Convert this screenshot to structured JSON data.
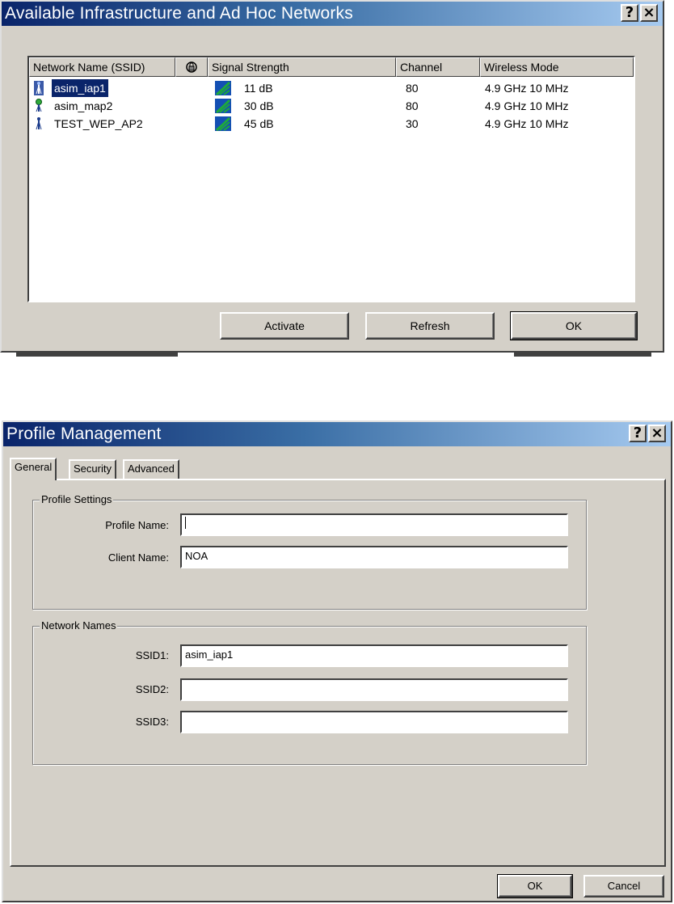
{
  "dialog1": {
    "title": "Available Infrastructure and Ad Hoc Networks",
    "help_icon": "?",
    "close_icon": "×",
    "columns": [
      "Network Name (SSID)",
      "",
      "Signal Strength",
      "Channel",
      "Wireless Mode"
    ],
    "column_icon": "encryption-lock-icon",
    "rows": [
      {
        "name": "asim_iap1",
        "signal": "11 dB",
        "channel": "80",
        "mode": "4.9 GHz 10 MHz",
        "icon": "infrastructure-tower-icon",
        "selected": true
      },
      {
        "name": "asim_map2",
        "signal": "30 dB",
        "channel": "80",
        "mode": "4.9 GHz 10 MHz",
        "icon": "adhoc-tower-icon",
        "selected": false
      },
      {
        "name": "TEST_WEP_AP2",
        "signal": "45 dB",
        "channel": "30",
        "mode": "4.9 GHz 10 MHz",
        "icon": "infrastructure-tower-icon",
        "selected": false
      }
    ],
    "buttons": {
      "activate": "Activate",
      "refresh": "Refresh",
      "ok": "OK"
    }
  },
  "dialog2": {
    "title": "Profile Management",
    "help_icon": "?",
    "close_icon": "×",
    "tabs": [
      "General",
      "Security",
      "Advanced"
    ],
    "active_tab": "General",
    "profile_settings": {
      "group_label": "Profile Settings",
      "profile_name_label": "Profile Name:",
      "profile_name_value": "",
      "client_name_label": "Client Name:",
      "client_name_value": "NOA"
    },
    "network_names": {
      "group_label": "Network Names",
      "ssid1_label": "SSID1:",
      "ssid1_value": "asim_iap1",
      "ssid2_label": "SSID2:",
      "ssid2_value": "",
      "ssid3_label": "SSID3:",
      "ssid3_value": ""
    },
    "buttons": {
      "ok": "OK",
      "cancel": "Cancel"
    }
  },
  "colors": {
    "dialog_face": "#d4d0c8",
    "title_gradient_start": "#0a246a",
    "title_gradient_end": "#a6caf0",
    "selection": "#0a246a",
    "signal_icon_green": "#1faa3a",
    "signal_icon_blue": "#1450b4"
  }
}
